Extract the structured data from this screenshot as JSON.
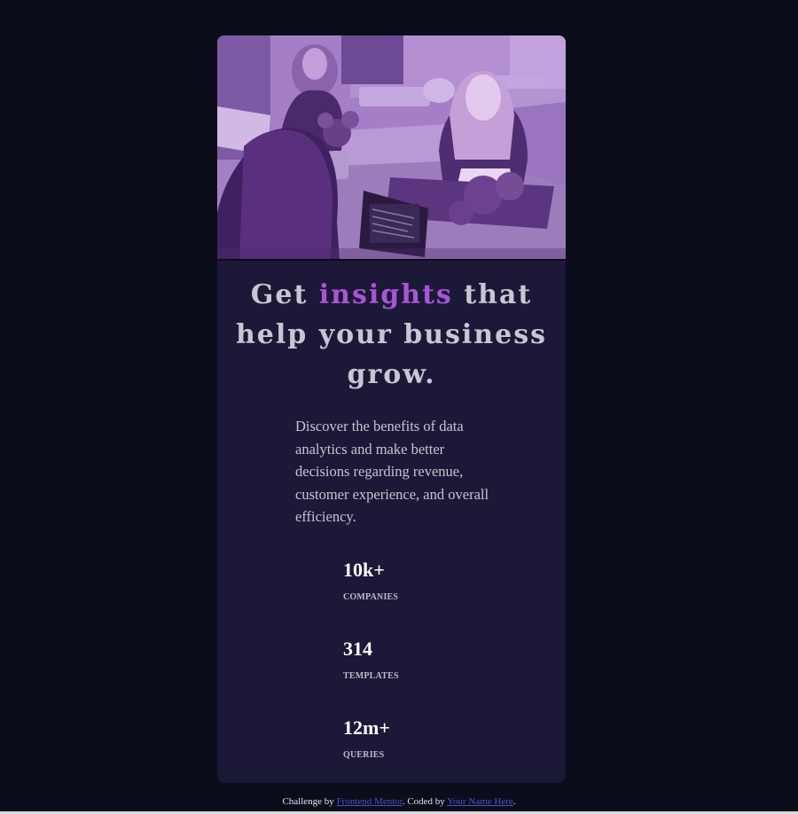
{
  "colors": {
    "page_background": "#0b0d1a",
    "card_background": "#1b1937",
    "accent": "#a855d6",
    "photo_tint": "#a47fc7",
    "heading_text": "#c9c6d4",
    "link": "#4a55c4"
  },
  "hero": {
    "image_icon": "team-working-at-desk-photo"
  },
  "headline": {
    "before": "Get ",
    "accent": "insights",
    "after": " that help your business grow."
  },
  "description": "Discover the benefits of data analytics and make better decisions regarding revenue, customer experience, and overall efficiency.",
  "stats": [
    {
      "value": "10k+",
      "label": "COMPANIES"
    },
    {
      "value": "314",
      "label": "TEMPLATES"
    },
    {
      "value": "12m+",
      "label": "QUERIES"
    }
  ],
  "attribution": {
    "prefix": "Challenge by ",
    "frontend_mentor": "Frontend Mentor",
    "middle": ". Coded by ",
    "author": "Your Name Here",
    "suffix": "."
  }
}
